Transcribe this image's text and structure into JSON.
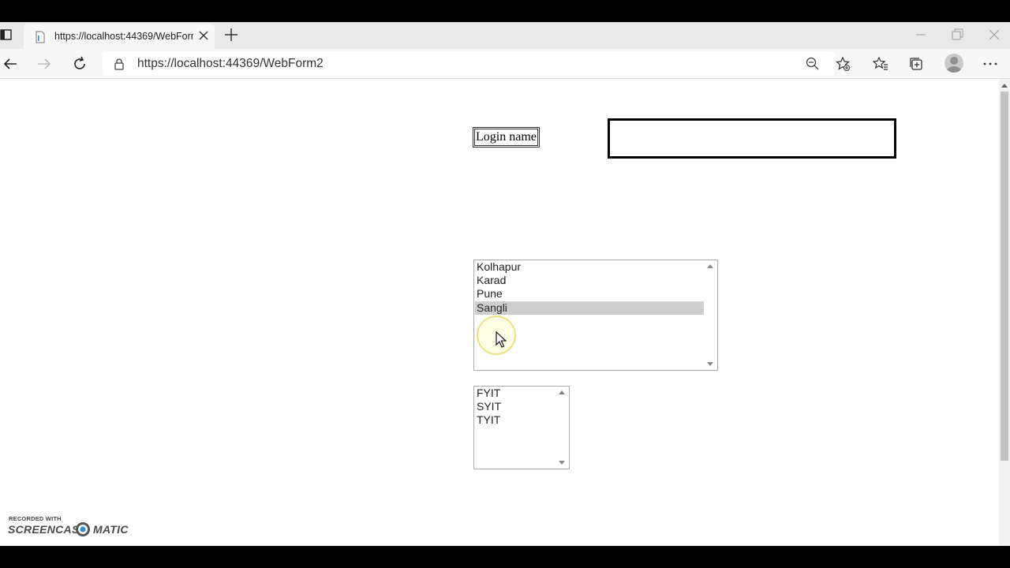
{
  "browser": {
    "tab": {
      "title": "https://localhost:44369/WebForm2",
      "icon": "page-icon"
    },
    "address_bar": {
      "url": "https://localhost:44369/WebForm2",
      "icon": "lock-icon"
    },
    "toolbar_icons": [
      "back-icon",
      "forward-icon",
      "refresh-icon",
      "zoom-out-icon",
      "add-favorite-icon",
      "favorites-icon",
      "collections-icon",
      "profile-icon",
      "more-icon"
    ]
  },
  "page": {
    "login_label": "Login name",
    "login_input": {
      "value": ""
    },
    "city_list": {
      "items": [
        "Kolhapur",
        "Karad",
        "Pune",
        "Sangli"
      ],
      "selected": "Sangli"
    },
    "course_list": {
      "items": [
        "FYIT",
        "SYIT",
        "TYIT"
      ]
    }
  },
  "watermark": {
    "top": "RECORDED WITH",
    "left": "SCREENCAST",
    "right": "MATIC"
  },
  "colors": {
    "selection": "#cecece",
    "cursor_halo": "#f3e98a"
  }
}
